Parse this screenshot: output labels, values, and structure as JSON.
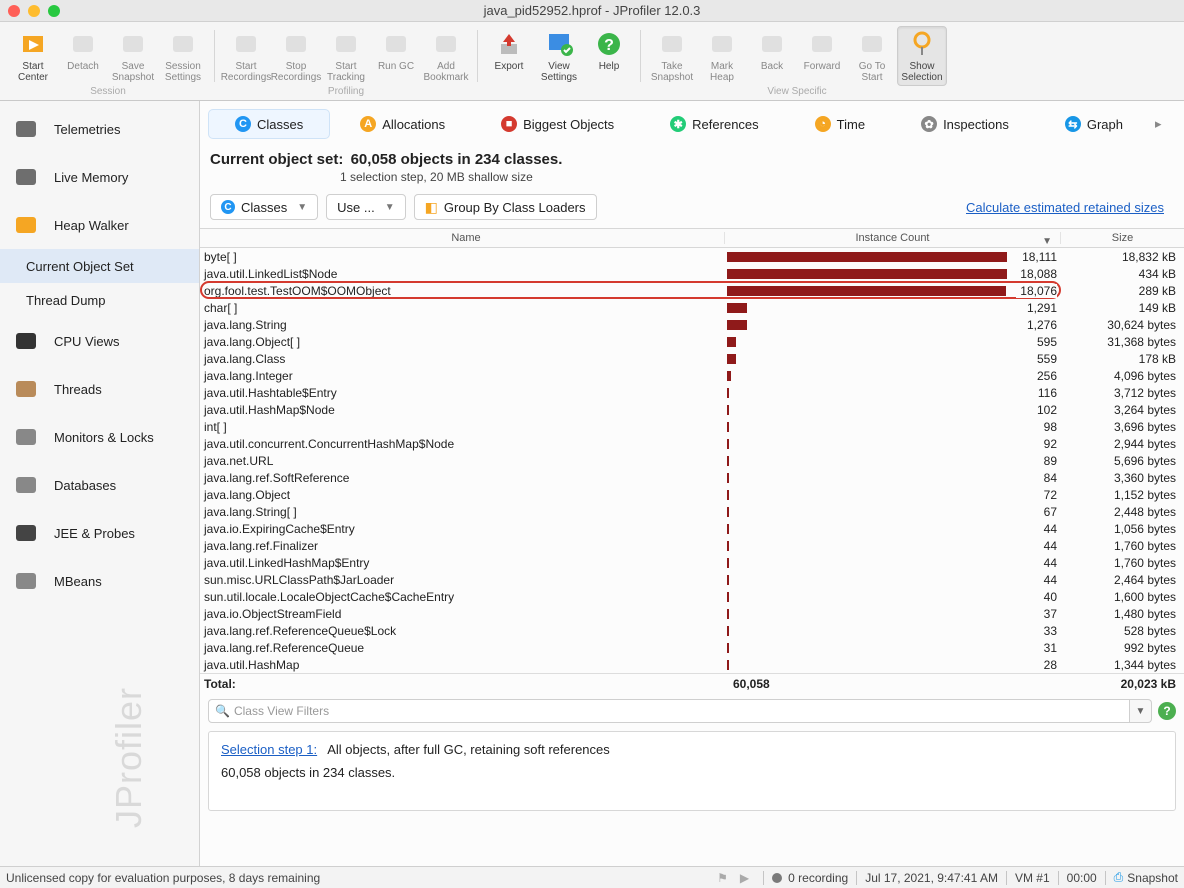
{
  "window": {
    "title": "java_pid52952.hprof - JProfiler 12.0.3"
  },
  "toolbar": {
    "groups": {
      "session": {
        "label": "Session",
        "items": [
          {
            "id": "start-center",
            "label": "Start\nCenter",
            "enabled": true
          },
          {
            "id": "detach",
            "label": "Detach",
            "enabled": false
          },
          {
            "id": "save-snapshot",
            "label": "Save\nSnapshot",
            "enabled": false
          },
          {
            "id": "session-settings",
            "label": "Session\nSettings",
            "enabled": false
          }
        ]
      },
      "profiling": {
        "label": "Profiling",
        "items": [
          {
            "id": "start-recordings",
            "label": "Start\nRecordings",
            "enabled": false
          },
          {
            "id": "stop-recordings",
            "label": "Stop\nRecordings",
            "enabled": false
          },
          {
            "id": "start-tracking",
            "label": "Start\nTracking",
            "enabled": false
          },
          {
            "id": "run-gc",
            "label": "Run GC",
            "enabled": false
          },
          {
            "id": "add-bookmark",
            "label": "Add\nBookmark",
            "enabled": false
          }
        ]
      },
      "misc1": {
        "label": "",
        "items": [
          {
            "id": "export",
            "label": "Export",
            "enabled": true
          },
          {
            "id": "view-settings",
            "label": "View\nSettings",
            "enabled": true
          },
          {
            "id": "help",
            "label": "Help",
            "enabled": true
          }
        ]
      },
      "view_specific": {
        "label": "View Specific",
        "items": [
          {
            "id": "take-snapshot",
            "label": "Take\nSnapshot",
            "enabled": false
          },
          {
            "id": "mark-heap",
            "label": "Mark\nHeap",
            "enabled": false
          },
          {
            "id": "back",
            "label": "Back",
            "enabled": false
          },
          {
            "id": "forward",
            "label": "Forward",
            "enabled": false
          },
          {
            "id": "go-to-start",
            "label": "Go To\nStart",
            "enabled": false
          },
          {
            "id": "show-selection",
            "label": "Show\nSelection",
            "enabled": true,
            "active": true
          }
        ]
      }
    }
  },
  "sidebar": {
    "items": [
      {
        "id": "telemetries",
        "label": "Telemetries"
      },
      {
        "id": "live-memory",
        "label": "Live Memory"
      },
      {
        "id": "heap-walker",
        "label": "Heap Walker"
      },
      {
        "id": "current-object-set",
        "label": "Current Object Set",
        "sub": true,
        "selected": true
      },
      {
        "id": "thread-dump",
        "label": "Thread Dump",
        "sub": true
      },
      {
        "id": "cpu-views",
        "label": "CPU Views"
      },
      {
        "id": "threads",
        "label": "Threads"
      },
      {
        "id": "monitors-locks",
        "label": "Monitors & Locks"
      },
      {
        "id": "databases",
        "label": "Databases"
      },
      {
        "id": "jee-probes",
        "label": "JEE & Probes"
      },
      {
        "id": "mbeans",
        "label": "MBeans"
      }
    ]
  },
  "views": [
    {
      "id": "classes",
      "label": "Classes",
      "selected": true
    },
    {
      "id": "allocations",
      "label": "Allocations"
    },
    {
      "id": "biggest-objects",
      "label": "Biggest Objects"
    },
    {
      "id": "references",
      "label": "References"
    },
    {
      "id": "time",
      "label": "Time"
    },
    {
      "id": "inspections",
      "label": "Inspections"
    },
    {
      "id": "graph",
      "label": "Graph"
    }
  ],
  "objectset": {
    "title_prefix": "Current object set:",
    "title_value": "60,058 objects in 234 classes.",
    "subtitle": "1 selection step, 20 MB shallow size"
  },
  "controls": {
    "classes_btn": "Classes",
    "use_btn": "Use ...",
    "groupby_btn": "Group By Class Loaders",
    "calc_link": "Calculate estimated retained sizes"
  },
  "table": {
    "col_name": "Name",
    "col_count": "Instance Count",
    "col_size": "Size",
    "max_count": 18111,
    "rows": [
      {
        "name": "byte[ ]",
        "count": 18111,
        "count_s": "18,111",
        "size": "18,832 kB"
      },
      {
        "name": "java.util.LinkedList$Node",
        "count": 18088,
        "count_s": "18,088",
        "size": "434 kB"
      },
      {
        "name": "org.fool.test.TestOOM$OOMObject",
        "count": 18076,
        "count_s": "18,076",
        "size": "289 kB",
        "highlight": true
      },
      {
        "name": "char[ ]",
        "count": 1291,
        "count_s": "1,291",
        "size": "149 kB"
      },
      {
        "name": "java.lang.String",
        "count": 1276,
        "count_s": "1,276",
        "size": "30,624 bytes"
      },
      {
        "name": "java.lang.Object[ ]",
        "count": 595,
        "count_s": "595",
        "size": "31,368 bytes"
      },
      {
        "name": "java.lang.Class",
        "count": 559,
        "count_s": "559",
        "size": "178 kB"
      },
      {
        "name": "java.lang.Integer",
        "count": 256,
        "count_s": "256",
        "size": "4,096 bytes"
      },
      {
        "name": "java.util.Hashtable$Entry",
        "count": 116,
        "count_s": "116",
        "size": "3,712 bytes"
      },
      {
        "name": "java.util.HashMap$Node",
        "count": 102,
        "count_s": "102",
        "size": "3,264 bytes"
      },
      {
        "name": "int[ ]",
        "count": 98,
        "count_s": "98",
        "size": "3,696 bytes"
      },
      {
        "name": "java.util.concurrent.ConcurrentHashMap$Node",
        "count": 92,
        "count_s": "92",
        "size": "2,944 bytes"
      },
      {
        "name": "java.net.URL",
        "count": 89,
        "count_s": "89",
        "size": "5,696 bytes"
      },
      {
        "name": "java.lang.ref.SoftReference",
        "count": 84,
        "count_s": "84",
        "size": "3,360 bytes"
      },
      {
        "name": "java.lang.Object",
        "count": 72,
        "count_s": "72",
        "size": "1,152 bytes"
      },
      {
        "name": "java.lang.String[ ]",
        "count": 67,
        "count_s": "67",
        "size": "2,448 bytes"
      },
      {
        "name": "java.io.ExpiringCache$Entry",
        "count": 44,
        "count_s": "44",
        "size": "1,056 bytes"
      },
      {
        "name": "java.lang.ref.Finalizer",
        "count": 44,
        "count_s": "44",
        "size": "1,760 bytes"
      },
      {
        "name": "java.util.LinkedHashMap$Entry",
        "count": 44,
        "count_s": "44",
        "size": "1,760 bytes"
      },
      {
        "name": "sun.misc.URLClassPath$JarLoader",
        "count": 44,
        "count_s": "44",
        "size": "2,464 bytes"
      },
      {
        "name": "sun.util.locale.LocaleObjectCache$CacheEntry",
        "count": 40,
        "count_s": "40",
        "size": "1,600 bytes"
      },
      {
        "name": "java.io.ObjectStreamField",
        "count": 37,
        "count_s": "37",
        "size": "1,480 bytes"
      },
      {
        "name": "java.lang.ref.ReferenceQueue$Lock",
        "count": 33,
        "count_s": "33",
        "size": "528 bytes"
      },
      {
        "name": "java.lang.ref.ReferenceQueue",
        "count": 31,
        "count_s": "31",
        "size": "992 bytes"
      },
      {
        "name": "java.util.HashMap",
        "count": 28,
        "count_s": "28",
        "size": "1,344 bytes"
      }
    ],
    "total_label": "Total:",
    "total_count": "60,058",
    "total_size": "20,023 kB"
  },
  "filter": {
    "placeholder": "Class View Filters",
    "glyph": "🔍"
  },
  "selection": {
    "step_label": "Selection step 1:",
    "step_text": "All objects, after full GC, retaining soft references",
    "summary": "60,058 objects in 234 classes."
  },
  "status": {
    "license": "Unlicensed copy for evaluation purposes, 8 days remaining",
    "recording": "0 recording",
    "timestamp": "Jul 17, 2021, 9:47:41 AM",
    "vm": "VM #1",
    "elapsed": "00:00",
    "snapshot": "Snapshot"
  },
  "watermark": "JProfiler"
}
